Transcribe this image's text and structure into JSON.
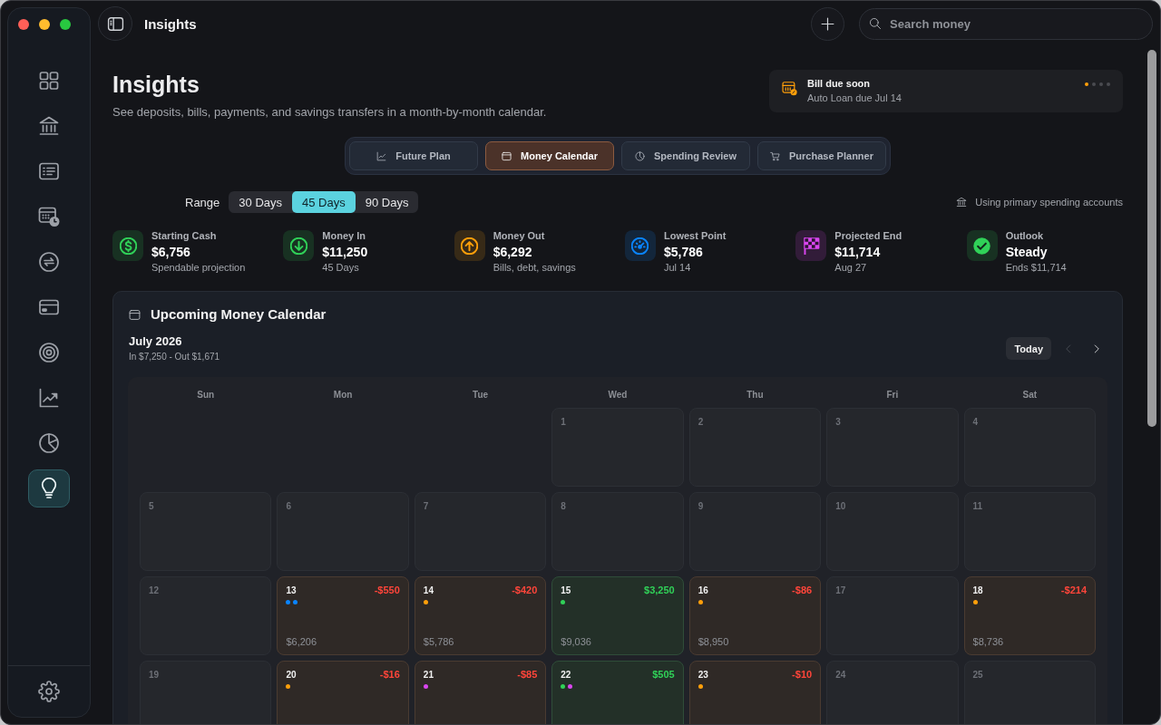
{
  "window": {
    "title": "Insights"
  },
  "sidebar": {
    "items": [
      {
        "selected": false
      },
      {
        "selected": false
      },
      {
        "selected": false
      },
      {
        "selected": false
      },
      {
        "selected": false
      },
      {
        "selected": false
      },
      {
        "selected": false
      },
      {
        "selected": false
      },
      {
        "selected": false
      },
      {
        "selected": true
      }
    ]
  },
  "toolbar": {
    "search": {
      "placeholder": "Search money"
    }
  },
  "header": {
    "title": "Insights",
    "subtitle": "See deposits, bills, payments, and savings transfers in a month-by-month calendar."
  },
  "notification": {
    "title": "Bill due soon",
    "text": "Auto Loan due Jul 14",
    "pages": [
      {
        "selected": true
      },
      {
        "selected": false
      },
      {
        "selected": false
      },
      {
        "selected": false
      }
    ]
  },
  "tabs": [
    {
      "label": "Future Plan",
      "selected": false
    },
    {
      "label": "Money Calendar",
      "selected": true
    },
    {
      "label": "Spending Review",
      "selected": false
    },
    {
      "label": "Purchase Planner",
      "selected": false
    }
  ],
  "range": {
    "label": "Range",
    "options": [
      {
        "label": "30 Days",
        "selected": false
      },
      {
        "label": "45 Days",
        "selected": true
      },
      {
        "label": "90 Days",
        "selected": false
      }
    ],
    "note": "Using primary spending accounts"
  },
  "stats": [
    {
      "label": "Starting Cash",
      "value": "$6,756",
      "detail": "Spendable projection",
      "color": "#30d158"
    },
    {
      "label": "Money In",
      "value": "$11,250",
      "detail": "45 Days",
      "color": "#30d158"
    },
    {
      "label": "Money Out",
      "value": "$6,292",
      "detail": "Bills, debt, savings",
      "color": "#ff9f0a"
    },
    {
      "label": "Lowest Point",
      "value": "$5,786",
      "detail": "Jul 14",
      "color": "#0a84ff"
    },
    {
      "label": "Projected End",
      "value": "$11,714",
      "detail": "Aug 27",
      "color": "#d946ef"
    },
    {
      "label": "Outlook",
      "value": "Steady",
      "detail": "Ends $11,714",
      "color": "#30d158"
    }
  ],
  "calendar": {
    "title": "Upcoming Money Calendar",
    "month": "July 2026",
    "summary": "In $7,250 - Out $1,671",
    "today_button": "Today",
    "prev": {
      "disabled": true
    },
    "next": {
      "disabled": false
    },
    "weekdays": [
      "Sun",
      "Mon",
      "Tue",
      "Wed",
      "Thu",
      "Fri",
      "Sat"
    ],
    "weeks": [
      [
        {
          "day": "1",
          "kind": "none"
        },
        {
          "day": "2",
          "kind": "none"
        },
        {
          "day": "3",
          "kind": "none"
        },
        {
          "day": "4",
          "kind": "none"
        }
      ],
      [
        {
          "day": "5",
          "kind": "none"
        },
        {
          "day": "6",
          "kind": "none"
        },
        {
          "day": "7",
          "kind": "none"
        },
        {
          "day": "8",
          "kind": "none"
        },
        {
          "day": "9",
          "kind": "none"
        },
        {
          "day": "10",
          "kind": "none"
        },
        {
          "day": "11",
          "kind": "none"
        }
      ],
      [
        {
          "day": "12",
          "kind": "none"
        },
        {
          "day": "13",
          "kind": "out",
          "amount": "-$550",
          "dots": [
            {
              "color": "#0a84ff"
            },
            {
              "color": "#0a84ff"
            }
          ],
          "balance": "$6,206"
        },
        {
          "day": "14",
          "kind": "out",
          "amount": "-$420",
          "dots": [
            {
              "color": "#ff9f0a"
            }
          ],
          "balance": "$5,786"
        },
        {
          "day": "15",
          "kind": "in",
          "amount": "$3,250",
          "dots": [
            {
              "color": "#30d158"
            }
          ],
          "balance": "$9,036"
        },
        {
          "day": "16",
          "kind": "out",
          "amount": "-$86",
          "dots": [
            {
              "color": "#ff9f0a"
            }
          ],
          "balance": "$8,950"
        },
        {
          "day": "17",
          "kind": "none"
        },
        {
          "day": "18",
          "kind": "out",
          "amount": "-$214",
          "dots": [
            {
              "color": "#ff9f0a"
            }
          ],
          "balance": "$8,736"
        }
      ],
      [
        {
          "day": "19",
          "kind": "none"
        },
        {
          "day": "20",
          "kind": "out",
          "amount": "-$16",
          "dots": [
            {
              "color": "#ff9f0a"
            }
          ]
        },
        {
          "day": "21",
          "kind": "out",
          "amount": "-$85",
          "dots": [
            {
              "color": "#d946ef"
            }
          ]
        },
        {
          "day": "22",
          "kind": "in",
          "amount": "$505",
          "dots": [
            {
              "color": "#30d158"
            },
            {
              "color": "#d946ef"
            }
          ]
        },
        {
          "day": "23",
          "kind": "out",
          "amount": "-$10",
          "dots": [
            {
              "color": "#ff9f0a"
            }
          ]
        },
        {
          "day": "24",
          "kind": "none"
        },
        {
          "day": "25",
          "kind": "none"
        }
      ]
    ]
  }
}
